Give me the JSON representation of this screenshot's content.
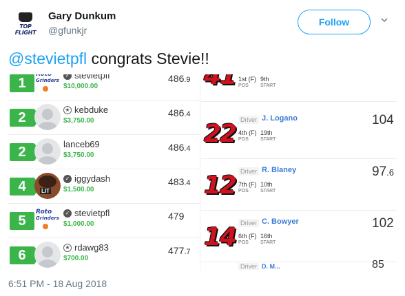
{
  "tweet": {
    "author_name": "Gary Dunkum",
    "author_handle": "@gfunkjr",
    "avatar_text": "TOP FLIGHT",
    "follow_label": "Follow",
    "mention": "@stevietpfl",
    "text": " congrats Stevie!!",
    "timestamp": "6:51 PM - 18 Aug 2018"
  },
  "leaderboard": [
    {
      "rank": "1",
      "user": "stevietpfl",
      "prize": "$10,000.00",
      "score_main": "486",
      "score_dec": ".9",
      "avatar": "rotogrinders"
    },
    {
      "rank": "2",
      "user": "kebduke",
      "prize": "$3,750.00",
      "score_main": "486",
      "score_dec": ".4",
      "avatar": "default"
    },
    {
      "rank": "2",
      "user": "lanceb69",
      "prize": "$3,750.00",
      "score_main": "486",
      "score_dec": ".4",
      "avatar": "default"
    },
    {
      "rank": "4",
      "user": "iggydash",
      "prize": "$1,500.00",
      "score_main": "483",
      "score_dec": ".4",
      "avatar": "lit"
    },
    {
      "rank": "5",
      "user": "stevietpfl",
      "prize": "$1,000.00",
      "score_main": "479",
      "score_dec": "",
      "avatar": "rotogrinders"
    },
    {
      "rank": "6",
      "user": "rdawg83",
      "prize": "$700.00",
      "score_main": "477",
      "score_dec": ".7",
      "avatar": "default"
    }
  ],
  "rotogrinders_logo": {
    "line1": "Roto",
    "line2": "Grinders"
  },
  "lit_tag": "LIT",
  "drivers_top": {
    "car": "41",
    "finish": "1st (F)",
    "start": "9th",
    "pos_label": "POS",
    "start_label": "START"
  },
  "drivers": [
    {
      "car": "22",
      "tag": "Driver",
      "name": "J. Logano",
      "finish": "4th (F)",
      "start": "19th",
      "pos_label": "POS",
      "start_label": "START",
      "pts_main": "104",
      "pts_dec": ""
    },
    {
      "car": "12",
      "tag": "Driver",
      "name": "R. Blaney",
      "finish": "7th (F)",
      "start": "10th",
      "pos_label": "POS",
      "start_label": "START",
      "pts_main": "97",
      "pts_dec": ".6"
    },
    {
      "car": "14",
      "tag": "Driver",
      "name": "C. Bowyer",
      "finish": "6th (F)",
      "start": "16th",
      "pos_label": "POS",
      "start_label": "START",
      "pts_main": "102",
      "pts_dec": ""
    }
  ],
  "drivers_bottom": {
    "tag": "Driver",
    "name": "D. M...",
    "pts": "85"
  }
}
